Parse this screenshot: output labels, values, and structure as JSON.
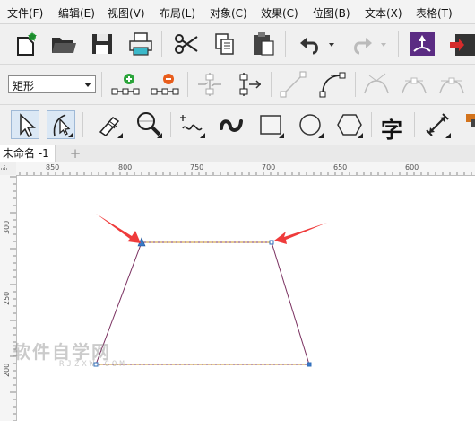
{
  "menu": {
    "items": [
      {
        "label": "文件(F)"
      },
      {
        "label": "编辑(E)"
      },
      {
        "label": "视图(V)"
      },
      {
        "label": "布局(L)"
      },
      {
        "label": "对象(C)"
      },
      {
        "label": "效果(C)"
      },
      {
        "label": "位图(B)"
      },
      {
        "label": "文本(X)"
      },
      {
        "label": "表格(T)"
      }
    ]
  },
  "property_bar": {
    "object_type_select": "矩形"
  },
  "toolbox": {
    "text_tool_label": "字"
  },
  "document_tabs": {
    "active_tab": "未命名 -1",
    "add_tab_glyph": "+"
  },
  "ruler": {
    "horizontal_labels": [
      "850",
      "800",
      "750",
      "700",
      "650",
      "600"
    ],
    "vertical_labels": [
      "300",
      "250",
      "200"
    ]
  },
  "watermark": {
    "title": "软件自学网",
    "url": "RJZXW.COM"
  },
  "colors": {
    "annotation_arrow": "#ef3b3b",
    "node_selected": "#3a79c7",
    "path_dashed_highlight": "#c8962a",
    "path_stroke": "#7a3060"
  }
}
